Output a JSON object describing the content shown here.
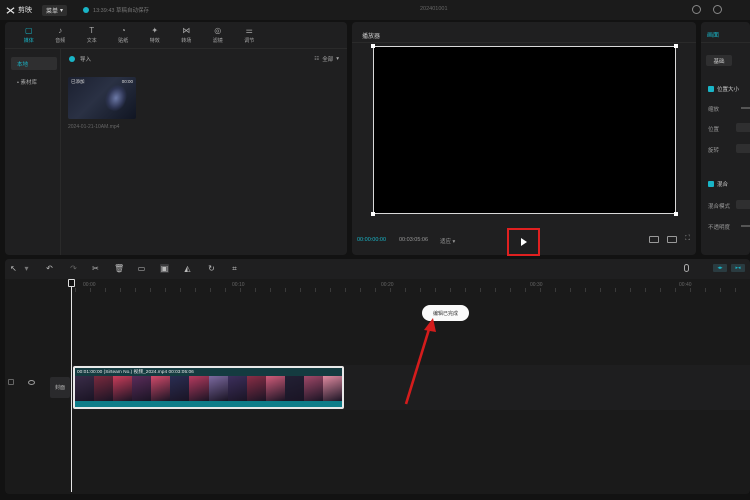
{
  "app": {
    "name": "剪映",
    "menu_label": "菜单",
    "autosave": "13:39:43 草稿自动保存",
    "project_title": "202401001"
  },
  "media": {
    "tabs": [
      {
        "label": "媒体",
        "icon": "media-icon",
        "glyph": "▢"
      },
      {
        "label": "音频",
        "icon": "audio-icon",
        "glyph": "♪"
      },
      {
        "label": "文本",
        "icon": "text-icon",
        "glyph": "T"
      },
      {
        "label": "贴纸",
        "icon": "sticker-icon",
        "glyph": "◔"
      },
      {
        "label": "特效",
        "icon": "effects-icon",
        "glyph": "✦"
      },
      {
        "label": "转场",
        "icon": "transition-icon",
        "glyph": "⋈"
      },
      {
        "label": "滤镜",
        "icon": "filter-icon",
        "glyph": "◎"
      },
      {
        "label": "调节",
        "icon": "adjust-icon",
        "glyph": "⚌"
      }
    ],
    "sidebar": [
      {
        "label": "本地"
      },
      {
        "label": "• 素材库"
      }
    ],
    "import_label": "导入",
    "sort_label": "全部",
    "thumb": {
      "tag_left": "已添加",
      "tag_right": "00:00",
      "name": "2024-01-21-10AM.mp4"
    }
  },
  "player": {
    "title": "播放器",
    "time_current": "00:00:00:00",
    "time_total": "00:03:05:06",
    "zoom_label": "适应"
  },
  "props": {
    "tab": "画面",
    "basic_btn": "基础",
    "section1": "位置大小",
    "labels": [
      "缩放",
      "位置",
      "旋转"
    ],
    "section2": "混合",
    "labels2": [
      "混合模式",
      "不透明度"
    ]
  },
  "timeline": {
    "ruler": [
      "00:00",
      "00:10",
      "00:20",
      "00:30",
      "00:40"
    ],
    "cover_label": "封面",
    "clip_label": "00:01:00:00 (Sirteam No.) 视频_2024.mp4   00:03:05:06",
    "tooltip": "编辑已完成"
  },
  "colors": {
    "accent": "#19b5c7",
    "highlight": "#e02020",
    "clip_bg": "#143b40"
  }
}
